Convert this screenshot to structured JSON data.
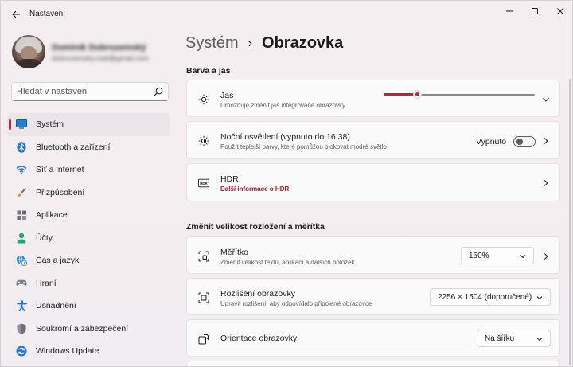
{
  "window": {
    "title": "Nastavení"
  },
  "profile": {
    "name": "Dominik Dobrozemský",
    "email": "dobrozemsky.mail@gmail.com"
  },
  "search": {
    "placeholder": "Hledat v nastavení"
  },
  "sidebar": {
    "items": [
      {
        "label": "Systém",
        "icon": "monitor-icon",
        "active": true
      },
      {
        "label": "Bluetooth a zařízení",
        "icon": "bluetooth-icon"
      },
      {
        "label": "Síť a internet",
        "icon": "wifi-icon"
      },
      {
        "label": "Přizpůsobení",
        "icon": "brush-icon"
      },
      {
        "label": "Aplikace",
        "icon": "apps-icon"
      },
      {
        "label": "Účty",
        "icon": "person-icon"
      },
      {
        "label": "Čas a jazyk",
        "icon": "globe-clock-icon"
      },
      {
        "label": "Hraní",
        "icon": "gamepad-icon"
      },
      {
        "label": "Usnadnění",
        "icon": "accessibility-icon"
      },
      {
        "label": "Soukromí a zabezpečení",
        "icon": "shield-icon"
      },
      {
        "label": "Windows Update",
        "icon": "update-icon"
      }
    ]
  },
  "breadcrumb": {
    "parent": "Systém",
    "separator": "›",
    "current": "Obrazovka"
  },
  "sections": {
    "color": "Barva a jas",
    "scale": "Změnit velikost rozložení a měřítka"
  },
  "brightness": {
    "title": "Jas",
    "subtitle": "Umožňuje změnit jas integrované obrazovky",
    "value": 0.22
  },
  "night_light": {
    "title": "Noční osvětlení (vypnuto do 16:38)",
    "subtitle": "Použít teplejší barvy, které pomůžou blokovat modré světlo",
    "state_label": "Vypnuto",
    "on": false
  },
  "hdr": {
    "title": "HDR",
    "link": "Další informace o HDR"
  },
  "scale": {
    "title": "Měřítko",
    "subtitle": "Změnit velikost textu, aplikací a dalších položek",
    "value": "150%"
  },
  "resolution": {
    "title": "Rozlišení obrazovky",
    "subtitle": "Upravit rozlišení, aby odpovídalo připojené obrazovce",
    "value": "2256 × 1504 (doporučené)"
  },
  "orientation": {
    "title": "Orientace obrazovky",
    "value": "Na šířku"
  },
  "colors": {
    "accent": "#c4203a",
    "link": "#a4132a"
  }
}
